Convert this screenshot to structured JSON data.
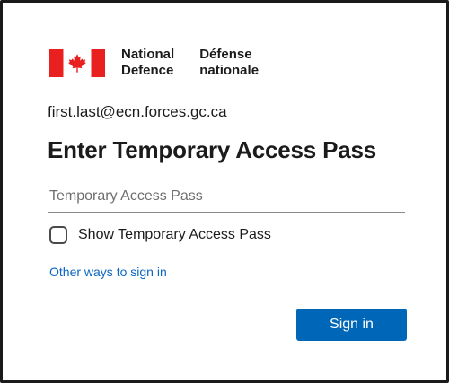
{
  "brand": {
    "logo_icon": "canada-flag-icon",
    "name_en_line1": "National",
    "name_en_line2": "Defence",
    "name_fr_line1": "Défense",
    "name_fr_line2": "nationale",
    "flag_red": "#e8201f"
  },
  "account": {
    "email": "first.last@ecn.forces.gc.ca"
  },
  "form": {
    "title": "Enter Temporary Access Pass",
    "pass_field": {
      "placeholder": "Temporary Access Pass",
      "value": ""
    },
    "show_pass_label": "Show Temporary Access Pass",
    "show_pass_checked": false,
    "other_ways_link": "Other ways to sign in",
    "sign_in_button": "Sign in"
  },
  "colors": {
    "accent": "#0067b8",
    "link": "#0b67c2",
    "text": "#1b1b1b"
  }
}
